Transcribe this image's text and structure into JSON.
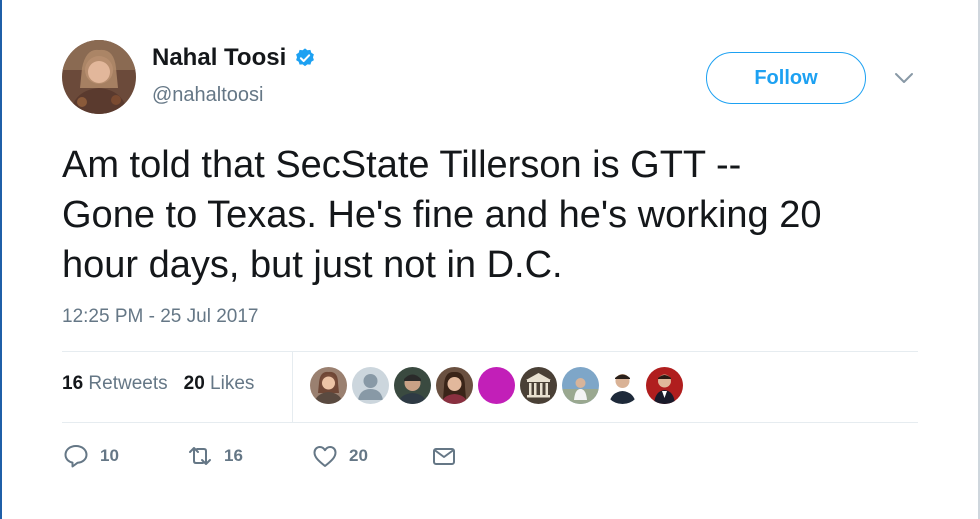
{
  "author": {
    "name": "Nahal Toosi",
    "handle": "@nahaltoosi",
    "verified_icon": "verified-badge-icon"
  },
  "follow_label": "Follow",
  "tweet": {
    "lines": [
      "Am told that SecState Tillerson is GTT --",
      "Gone to Texas. He's fine and he's working 20",
      "hour days, but just not in D.C."
    ],
    "timestamp": "12:25 PM - 25 Jul 2017"
  },
  "stats": {
    "retweets_count": "16",
    "retweets_label": "Retweets",
    "likes_count": "20",
    "likes_label": "Likes"
  },
  "actions": {
    "reply_count": "10",
    "retweet_count": "16",
    "like_count": "20"
  },
  "colors": {
    "accent": "#1da1f2",
    "text": "#14171a",
    "muted": "#657786",
    "border": "#e6ecf0"
  }
}
